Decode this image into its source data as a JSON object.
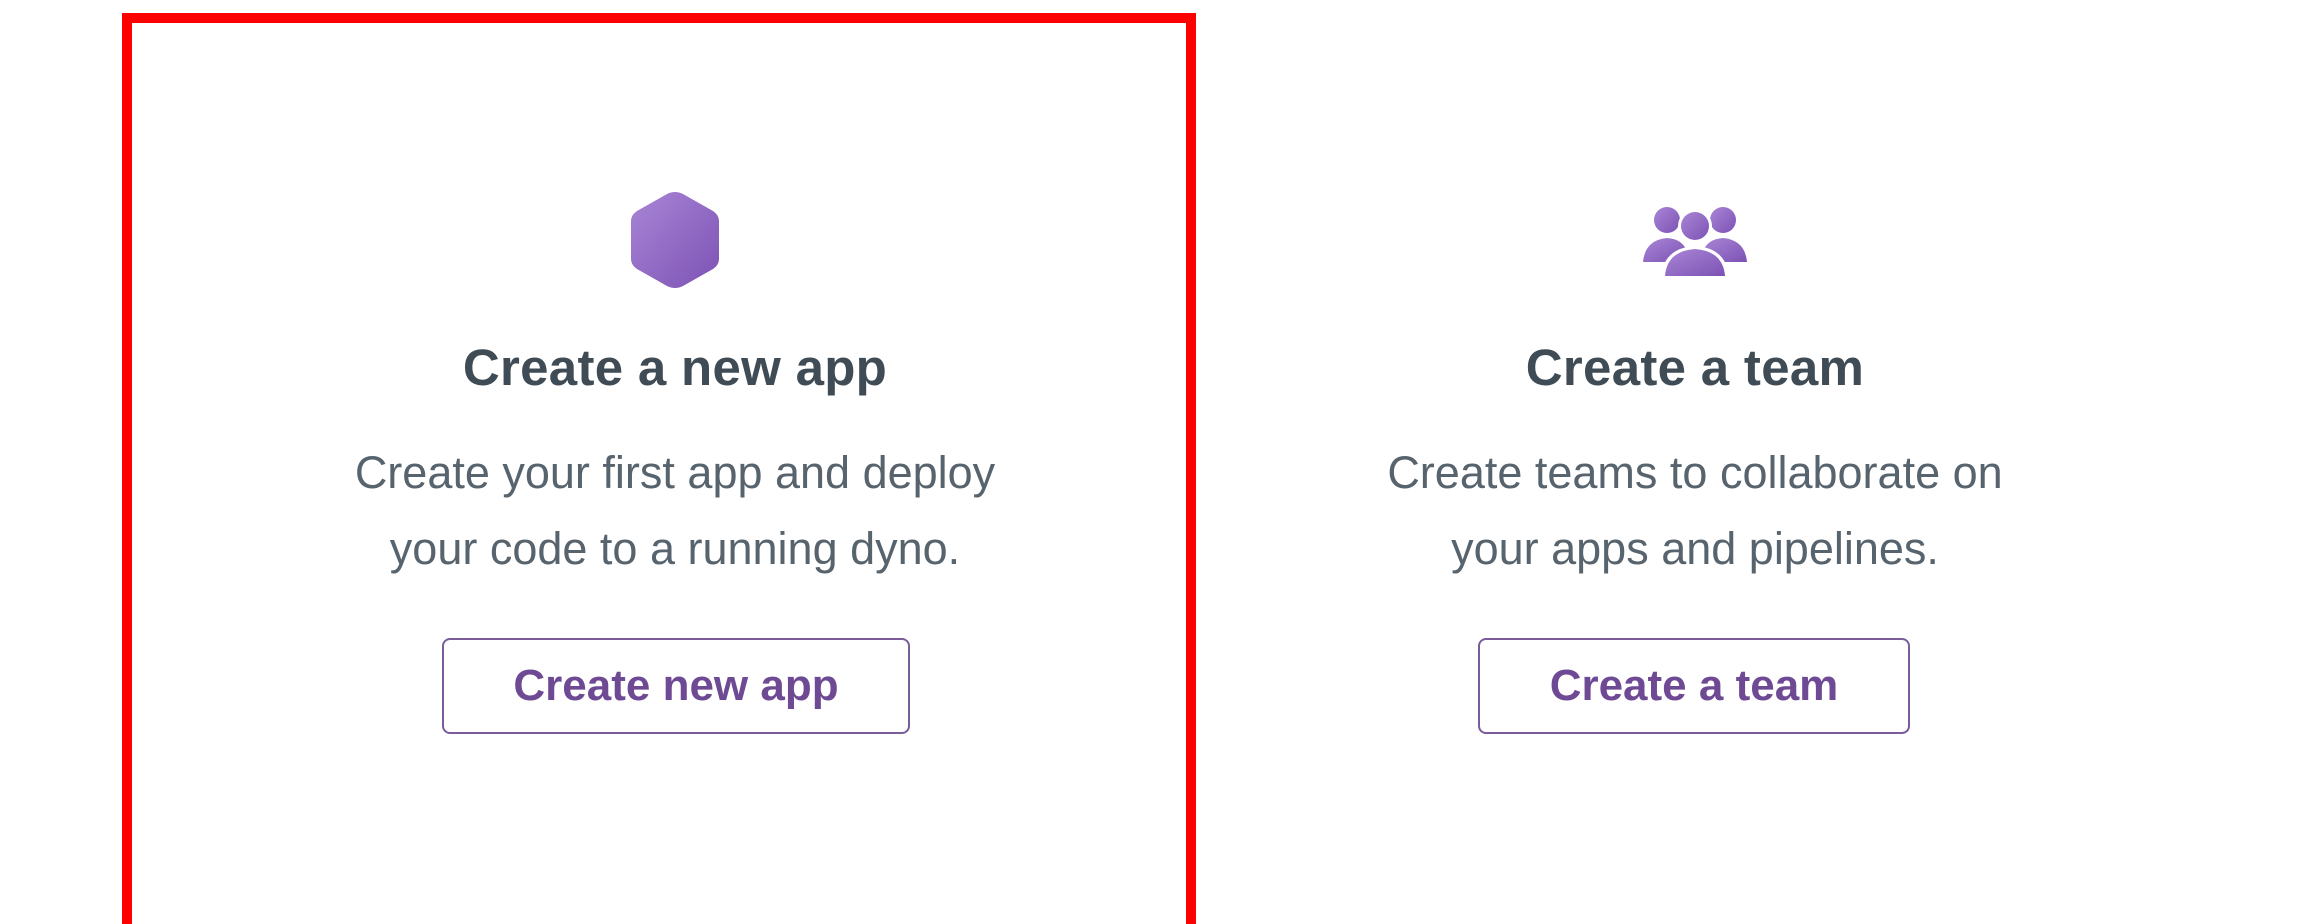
{
  "cards": {
    "app": {
      "icon": "hexagon-app-icon",
      "title": "Create a new app",
      "description_line1": "Create your first app and deploy",
      "description_line2": "your code to a running dyno.",
      "button_label": "Create new app"
    },
    "team": {
      "icon": "team-people-icon",
      "title": "Create a team",
      "description_line1": "Create teams to collaborate on",
      "description_line2": "your apps and pipelines.",
      "button_label": "Create a team"
    }
  },
  "colors": {
    "accent_purple": "#7a5c9b",
    "icon_purple": "#9a6dc4",
    "title_text": "#3f4b55",
    "body_text": "#57636d",
    "highlight_red": "#ff0000"
  }
}
